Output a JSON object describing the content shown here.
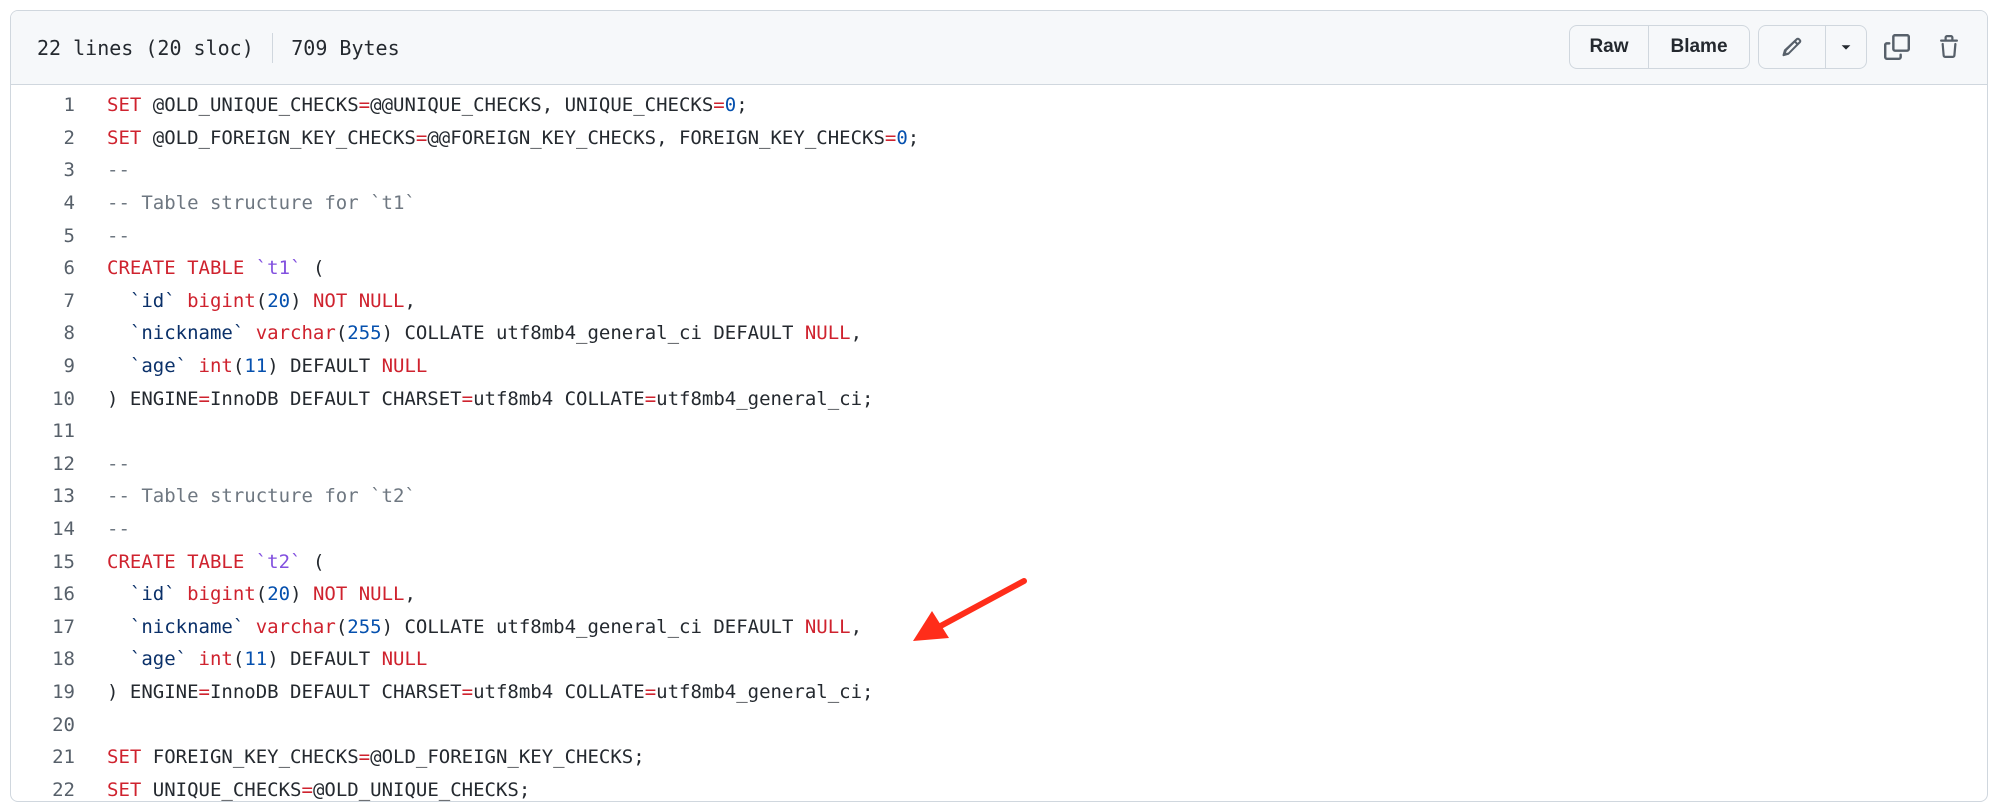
{
  "header": {
    "lines_info": "22 lines (20 sloc)",
    "size_info": "709 Bytes",
    "raw_label": "Raw",
    "blame_label": "Blame"
  },
  "icons": {
    "edit": "pencil-icon",
    "dropdown": "triangle-down-icon",
    "copy": "copy-icon",
    "delete": "trash-icon",
    "annotation": "red-arrow"
  },
  "colors": {
    "keyword": "#cf222e",
    "comment": "#6e7781",
    "number": "#0550ae",
    "identifier": "#0a3069",
    "table_name": "#8250df",
    "arrow": "#ff2d1a"
  },
  "code": [
    {
      "num": "1",
      "segs": [
        {
          "t": "SET",
          "c": "k"
        },
        {
          "t": " @OLD_UNIQUE_CHECKS"
        },
        {
          "t": "=",
          "c": "k"
        },
        {
          "t": "@@UNIQUE_CHECKS, UNIQUE_CHECKS"
        },
        {
          "t": "=",
          "c": "k"
        },
        {
          "t": "0",
          "c": "n"
        },
        {
          "t": ";"
        }
      ]
    },
    {
      "num": "2",
      "segs": [
        {
          "t": "SET",
          "c": "k"
        },
        {
          "t": " @OLD_FOREIGN_KEY_CHECKS"
        },
        {
          "t": "=",
          "c": "k"
        },
        {
          "t": "@@FOREIGN_KEY_CHECKS, FOREIGN_KEY_CHECKS"
        },
        {
          "t": "=",
          "c": "k"
        },
        {
          "t": "0",
          "c": "n"
        },
        {
          "t": ";"
        }
      ]
    },
    {
      "num": "3",
      "segs": [
        {
          "t": "--",
          "c": "c"
        }
      ]
    },
    {
      "num": "4",
      "segs": [
        {
          "t": "-- Table structure for `t1`",
          "c": "c"
        }
      ]
    },
    {
      "num": "5",
      "segs": [
        {
          "t": "--",
          "c": "c"
        }
      ]
    },
    {
      "num": "6",
      "segs": [
        {
          "t": "CREATE TABLE",
          "c": "k"
        },
        {
          "t": " "
        },
        {
          "t": "`t1`",
          "c": "t"
        },
        {
          "t": " ("
        }
      ]
    },
    {
      "num": "7",
      "segs": [
        {
          "t": "  "
        },
        {
          "t": "`id`",
          "c": "q"
        },
        {
          "t": " "
        },
        {
          "t": "bigint",
          "c": "k"
        },
        {
          "t": "("
        },
        {
          "t": "20",
          "c": "n"
        },
        {
          "t": ") "
        },
        {
          "t": "NOT NULL",
          "c": "k"
        },
        {
          "t": ","
        }
      ]
    },
    {
      "num": "8",
      "segs": [
        {
          "t": "  "
        },
        {
          "t": "`nickname`",
          "c": "q"
        },
        {
          "t": " "
        },
        {
          "t": "varchar",
          "c": "k"
        },
        {
          "t": "("
        },
        {
          "t": "255",
          "c": "n"
        },
        {
          "t": ") COLLATE utf8mb4_general_ci DEFAULT "
        },
        {
          "t": "NULL",
          "c": "k"
        },
        {
          "t": ","
        }
      ]
    },
    {
      "num": "9",
      "segs": [
        {
          "t": "  "
        },
        {
          "t": "`age`",
          "c": "q"
        },
        {
          "t": " "
        },
        {
          "t": "int",
          "c": "k"
        },
        {
          "t": "("
        },
        {
          "t": "11",
          "c": "n"
        },
        {
          "t": ") DEFAULT "
        },
        {
          "t": "NULL",
          "c": "k"
        }
      ]
    },
    {
      "num": "10",
      "segs": [
        {
          "t": ") ENGINE"
        },
        {
          "t": "=",
          "c": "k"
        },
        {
          "t": "InnoDB DEFAULT CHARSET"
        },
        {
          "t": "=",
          "c": "k"
        },
        {
          "t": "utf8mb4 COLLATE"
        },
        {
          "t": "=",
          "c": "k"
        },
        {
          "t": "utf8mb4_general_ci;"
        }
      ]
    },
    {
      "num": "11",
      "segs": []
    },
    {
      "num": "12",
      "segs": [
        {
          "t": "--",
          "c": "c"
        }
      ]
    },
    {
      "num": "13",
      "segs": [
        {
          "t": "-- Table structure for `t2`",
          "c": "c"
        }
      ]
    },
    {
      "num": "14",
      "segs": [
        {
          "t": "--",
          "c": "c"
        }
      ]
    },
    {
      "num": "15",
      "segs": [
        {
          "t": "CREATE TABLE",
          "c": "k"
        },
        {
          "t": " "
        },
        {
          "t": "`t2`",
          "c": "t"
        },
        {
          "t": " ("
        }
      ]
    },
    {
      "num": "16",
      "segs": [
        {
          "t": "  "
        },
        {
          "t": "`id`",
          "c": "q"
        },
        {
          "t": " "
        },
        {
          "t": "bigint",
          "c": "k"
        },
        {
          "t": "("
        },
        {
          "t": "20",
          "c": "n"
        },
        {
          "t": ") "
        },
        {
          "t": "NOT NULL",
          "c": "k"
        },
        {
          "t": ","
        }
      ]
    },
    {
      "num": "17",
      "segs": [
        {
          "t": "  "
        },
        {
          "t": "`nickname`",
          "c": "q"
        },
        {
          "t": " "
        },
        {
          "t": "varchar",
          "c": "k"
        },
        {
          "t": "("
        },
        {
          "t": "255",
          "c": "n"
        },
        {
          "t": ") COLLATE utf8mb4_general_ci DEFAULT "
        },
        {
          "t": "NULL",
          "c": "k"
        },
        {
          "t": ","
        }
      ]
    },
    {
      "num": "18",
      "segs": [
        {
          "t": "  "
        },
        {
          "t": "`age`",
          "c": "q"
        },
        {
          "t": " "
        },
        {
          "t": "int",
          "c": "k"
        },
        {
          "t": "("
        },
        {
          "t": "11",
          "c": "n"
        },
        {
          "t": ") DEFAULT "
        },
        {
          "t": "NULL",
          "c": "k"
        }
      ]
    },
    {
      "num": "19",
      "segs": [
        {
          "t": ") ENGINE"
        },
        {
          "t": "=",
          "c": "k"
        },
        {
          "t": "InnoDB DEFAULT CHARSET"
        },
        {
          "t": "=",
          "c": "k"
        },
        {
          "t": "utf8mb4 COLLATE"
        },
        {
          "t": "=",
          "c": "k"
        },
        {
          "t": "utf8mb4_general_ci;"
        }
      ]
    },
    {
      "num": "20",
      "segs": []
    },
    {
      "num": "21",
      "segs": [
        {
          "t": "SET",
          "c": "k"
        },
        {
          "t": " FOREIGN_KEY_CHECKS"
        },
        {
          "t": "=",
          "c": "k"
        },
        {
          "t": "@OLD_FOREIGN_KEY_CHECKS;"
        }
      ]
    },
    {
      "num": "22",
      "segs": [
        {
          "t": "SET",
          "c": "k"
        },
        {
          "t": " UNIQUE_CHECKS"
        },
        {
          "t": "=",
          "c": "k"
        },
        {
          "t": "@OLD_UNIQUE_CHECKS;"
        }
      ]
    }
  ]
}
